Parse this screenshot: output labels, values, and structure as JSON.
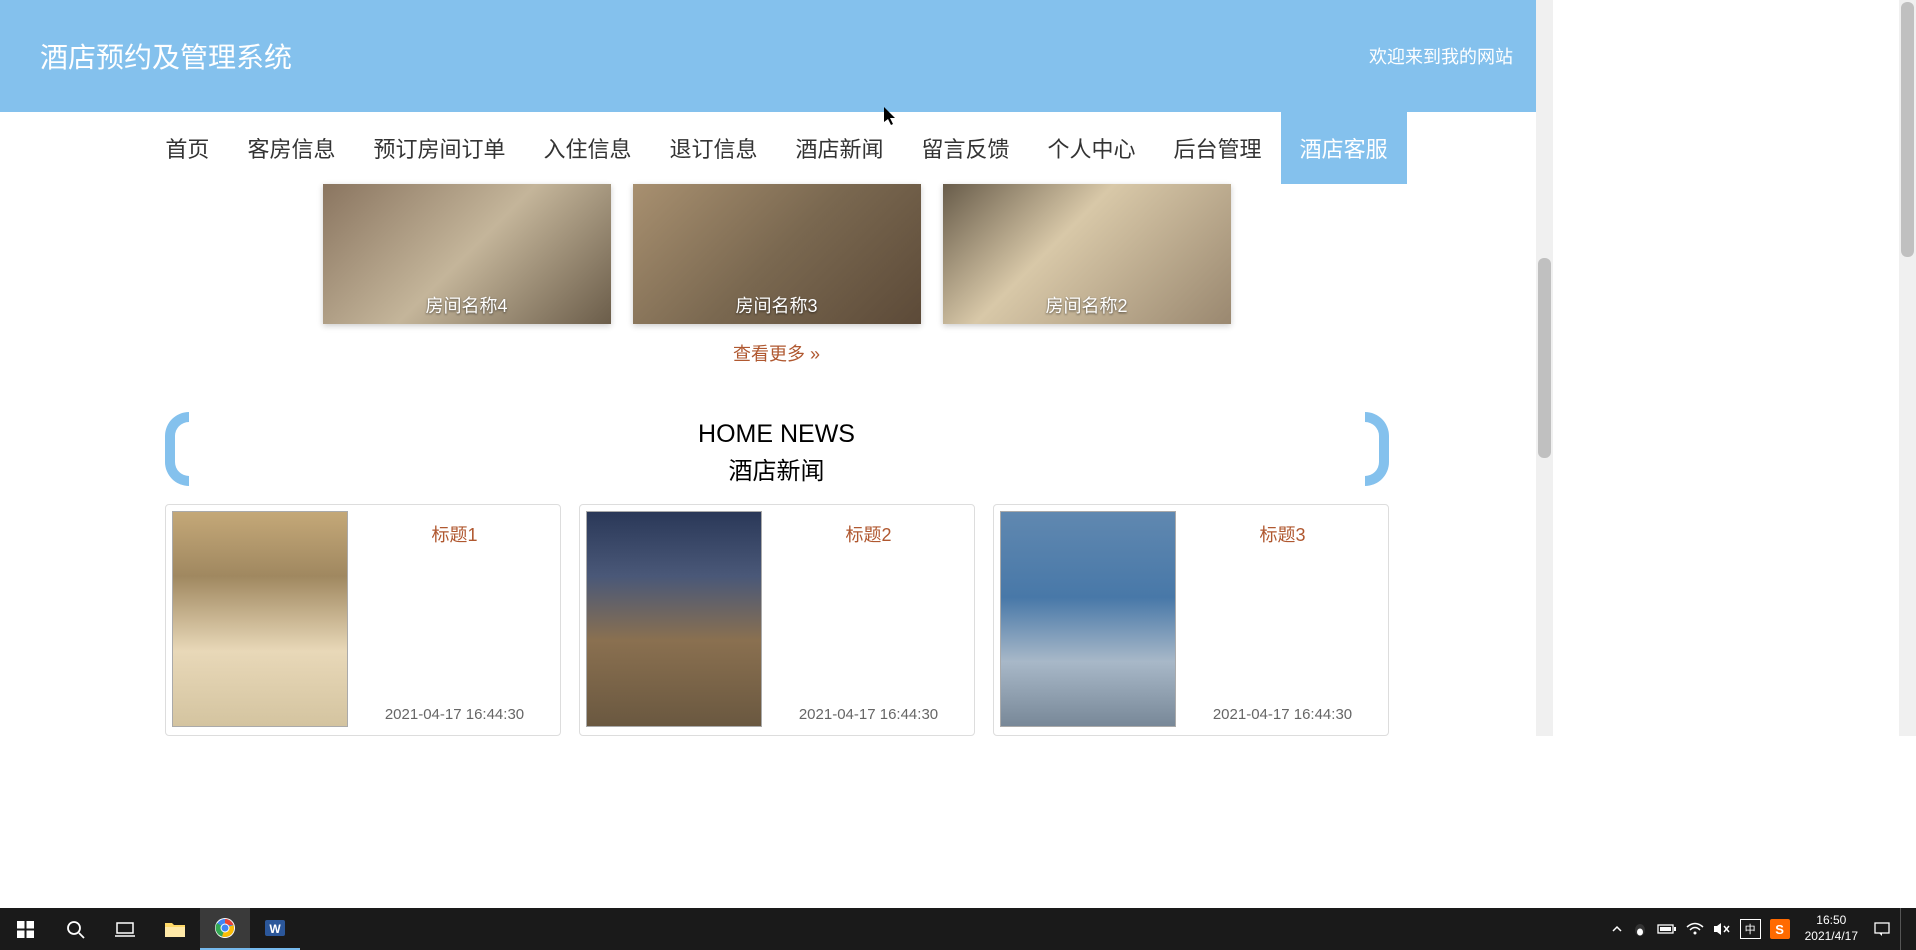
{
  "header": {
    "title": "酒店预约及管理系统",
    "welcome": "欢迎来到我的网站"
  },
  "nav": {
    "items": [
      {
        "label": "首页",
        "active": false
      },
      {
        "label": "客房信息",
        "active": false
      },
      {
        "label": "预订房间订单",
        "active": false
      },
      {
        "label": "入住信息",
        "active": false
      },
      {
        "label": "退订信息",
        "active": false
      },
      {
        "label": "酒店新闻",
        "active": false
      },
      {
        "label": "留言反馈",
        "active": false
      },
      {
        "label": "个人中心",
        "active": false
      },
      {
        "label": "后台管理",
        "active": false
      },
      {
        "label": "酒店客服",
        "active": true
      }
    ]
  },
  "rooms": [
    {
      "name": "房间名称4"
    },
    {
      "name": "房间名称3"
    },
    {
      "name": "房间名称2"
    }
  ],
  "view_more": "查看更多",
  "news_section": {
    "title_en": "HOME NEWS",
    "title_cn": "酒店新闻"
  },
  "news": [
    {
      "title": "标题1",
      "time": "2021-04-17 16:44:30"
    },
    {
      "title": "标题2",
      "time": "2021-04-17 16:44:30"
    },
    {
      "title": "标题3",
      "time": "2021-04-17 16:44:30"
    }
  ],
  "taskbar": {
    "ime": "中",
    "sogou": "S",
    "time": "16:50",
    "date": "2021/4/17"
  }
}
